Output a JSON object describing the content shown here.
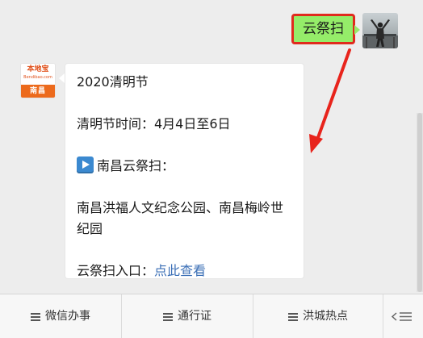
{
  "chat": {
    "outgoing": {
      "text": "云祭扫"
    },
    "incoming": {
      "sender_logo": {
        "brand": "本地宝",
        "domain": "Bendibao.com",
        "city": "南昌"
      },
      "lines": {
        "title": "2020清明节",
        "date_line": "清明节时间：4月4日至6日",
        "section_title": "南昌云祭扫：",
        "section_icon": "play-button-icon",
        "venues": "南昌洪福人文纪念公园、南昌梅岭世纪园",
        "entry_label": "云祭扫入口：",
        "entry_link": "点此查看"
      }
    }
  },
  "menu": {
    "items": [
      {
        "label": "微信办事",
        "icon": "menu-list-icon"
      },
      {
        "label": "通行证",
        "icon": "menu-list-icon"
      },
      {
        "label": "洪城热点",
        "icon": "menu-list-icon"
      }
    ],
    "keyboard_icon": "keyboard-toggle-icon"
  },
  "colors": {
    "chat_bg": "#ededed",
    "outgoing_bubble": "#95ec69",
    "highlight_border": "#e02a1d",
    "annotation_arrow": "#e8241c",
    "link": "#3b6fb6",
    "brand_orange": "#ec6a1c"
  }
}
